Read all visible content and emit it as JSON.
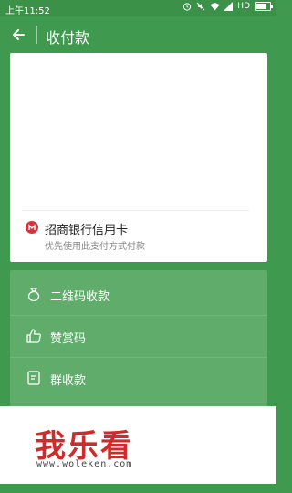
{
  "status_bar": {
    "time": "上午11:52",
    "network": "HD"
  },
  "header": {
    "title": "收付款",
    "back_icon": "back-arrow-icon"
  },
  "payment_card": {
    "bank_name": "招商银行信用卡",
    "hint": "优先使用此支付方式付款",
    "bank_icon": "cmb-logo-icon"
  },
  "menu": {
    "items": [
      {
        "label": "二维码收款",
        "icon": "money-bag-icon"
      },
      {
        "label": "赞赏码",
        "icon": "thumbs-up-icon"
      },
      {
        "label": "群收款",
        "icon": "document-icon"
      }
    ]
  },
  "watermark": {
    "text": "我乐看",
    "url": "www.woleken.com"
  },
  "colors": {
    "primary_green": "#3f9a4f",
    "menu_green": "#5fac6b",
    "brand_red": "#d12a2a"
  }
}
